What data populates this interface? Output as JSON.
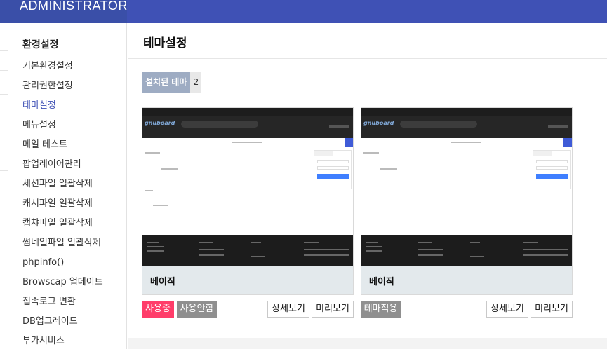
{
  "header": {
    "brand": "ADMINISTRATOR"
  },
  "sidebar": {
    "heading": "환경설정",
    "items": [
      {
        "label": "기본환경설정"
      },
      {
        "label": "관리권한설정"
      },
      {
        "label": "테마설정",
        "active": true
      },
      {
        "label": "메뉴설정"
      },
      {
        "label": "메일 테스트"
      },
      {
        "label": "팝업레이어관리"
      },
      {
        "label": "세션파일 일괄삭제"
      },
      {
        "label": "캐시파일 일괄삭제"
      },
      {
        "label": "캡챠파일 일괄삭제"
      },
      {
        "label": "썸네일파일 일괄삭제"
      },
      {
        "label": "phpinfo()"
      },
      {
        "label": "Browscap 업데이트"
      },
      {
        "label": "접속로그 변환"
      },
      {
        "label": "DB업그레이드"
      },
      {
        "label": "부가서비스"
      }
    ]
  },
  "main": {
    "title": "테마설정",
    "installed_label": "설치된 테마",
    "installed_count": "2",
    "themes": [
      {
        "name": "베이직",
        "status_button": "사용중",
        "secondary_button": "사용안함",
        "detail_button": "상세보기",
        "preview_button": "미리보기"
      },
      {
        "name": "베이직",
        "status_button": "테마적용",
        "detail_button": "상세보기",
        "preview_button": "미리보기"
      }
    ]
  },
  "colors": {
    "header": "#3f51b5",
    "active_menu": "#3f51b5",
    "in_use": "#ff3d6a",
    "inactive": "#8f8f8f",
    "badge": "#9eacc3"
  }
}
